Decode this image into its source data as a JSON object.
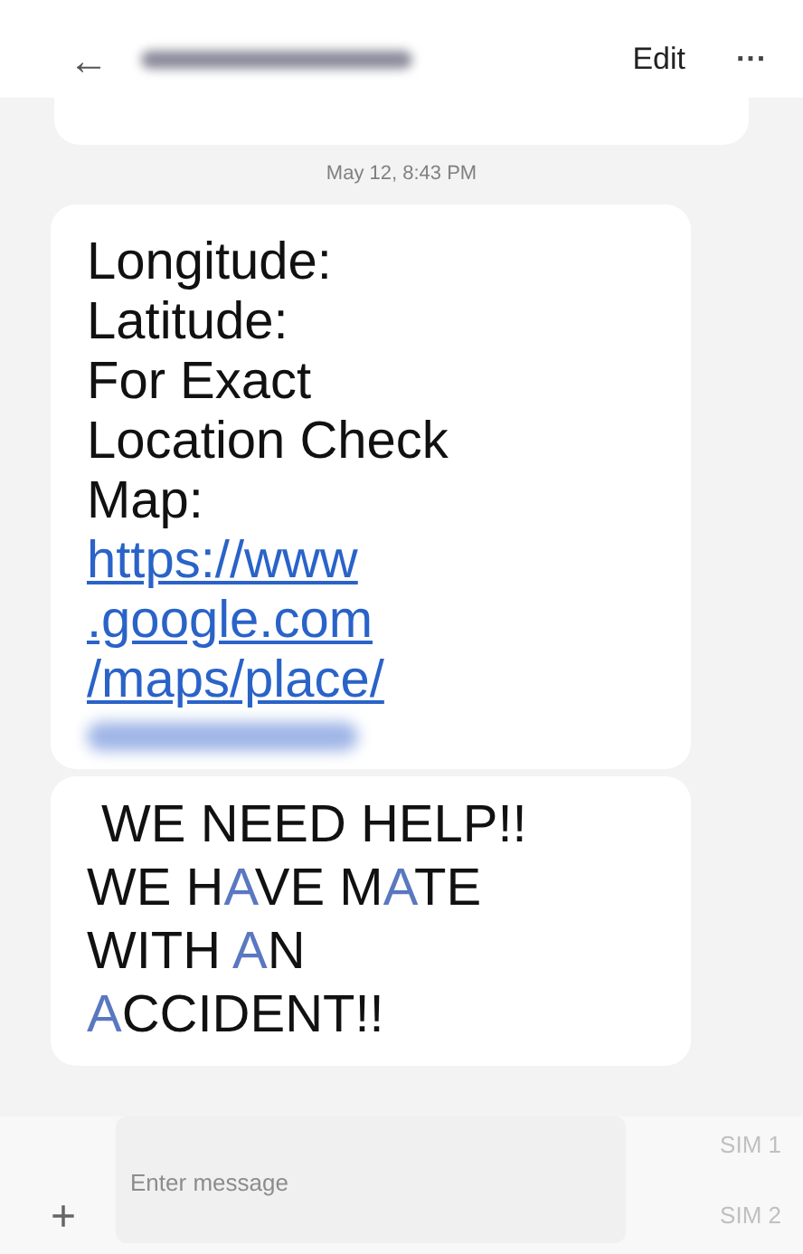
{
  "header": {
    "back": "←",
    "action": "Edit",
    "more": "···"
  },
  "timestamp": "May 12, 8:43 PM",
  "message_1": {
    "lines": [
      "Longitude:",
      "Latitude:",
      "For Exact",
      "Location Check",
      "Map:"
    ],
    "link_lines": [
      "https://www",
      ".google.com",
      "/maps/place/"
    ]
  },
  "message_2": {
    "lines": [
      [
        {
          "text": " WE NEED HELP!!",
          "highlighted": false
        }
      ],
      [
        {
          "text": "WE H",
          "highlighted": false
        },
        {
          "text": "A",
          "highlighted": true
        },
        {
          "text": "VE M",
          "highlighted": false
        },
        {
          "text": "A",
          "highlighted": true
        },
        {
          "text": "TE",
          "highlighted": false
        }
      ],
      [
        {
          "text": "WITH ",
          "highlighted": false
        },
        {
          "text": "A",
          "highlighted": true
        },
        {
          "text": "N",
          "highlighted": false
        }
      ],
      [
        {
          "text": "A",
          "highlighted": true
        },
        {
          "text": "CCIDENT!!",
          "highlighted": false
        }
      ]
    ]
  },
  "composer": {
    "add": "+",
    "placeholder": "Enter message",
    "sims": [
      "SIM 1",
      "SIM 2"
    ]
  }
}
